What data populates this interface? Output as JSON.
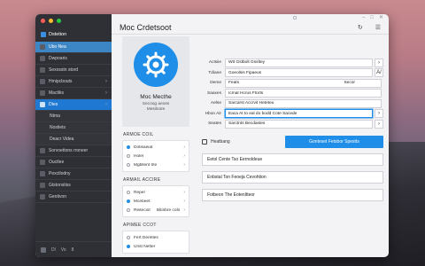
{
  "window": {
    "title": "Moc Crdetsoot"
  },
  "sidebar": {
    "header": "Dstetion",
    "items": [
      {
        "label": "Ubo Nea",
        "icon": "home-icon",
        "state": "first"
      },
      {
        "label": "Dwpoaris",
        "icon": "grid-icon",
        "state": ""
      },
      {
        "label": "Sexosstn stord",
        "icon": "shield-icon",
        "state": ""
      },
      {
        "label": "Hmipcbouts",
        "icon": "folder-icon",
        "state": "chev"
      },
      {
        "label": "Mactiks",
        "icon": "chart-icon",
        "state": "chev"
      },
      {
        "label": "Dtes",
        "icon": "user-icon",
        "state": "selected"
      },
      {
        "label": "Ntma",
        "icon": "",
        "state": "child"
      },
      {
        "label": "Nostiets",
        "icon": "",
        "state": "child"
      },
      {
        "label": "Deacr Videa",
        "icon": "",
        "state": "child"
      },
      {
        "label": "Sorvoettons rroneer",
        "icon": "list-icon",
        "state": ""
      },
      {
        "label": "Ouctlee",
        "icon": "doc-icon",
        "state": ""
      },
      {
        "label": "Pexctlodny",
        "icon": "chart-icon",
        "state": ""
      },
      {
        "label": "Gtstonstiss",
        "icon": "gear-icon",
        "state": ""
      },
      {
        "label": "Geotivon",
        "icon": "gear-icon",
        "state": ""
      }
    ],
    "bottom": {
      "left": "Dl",
      "mid": "Vo",
      "right": "8"
    }
  },
  "profile": {
    "name": "Moc Mecthe",
    "sub1": "Secoog aeoss",
    "sub2": "Mesiloote"
  },
  "sections": [
    {
      "title": "ARMOE COIL",
      "rows": [
        {
          "label": "Dotisaeiat",
          "on": true
        },
        {
          "label": "Holel",
          "on": false
        },
        {
          "label": "Mgbllent trle",
          "on": false
        }
      ]
    },
    {
      "title": "ARMAIL ACCIRE",
      "rows": [
        {
          "label": "Reper",
          "on": false,
          "suffix": ""
        },
        {
          "label": "Mcebeet",
          "on": true,
          "suffix": ""
        },
        {
          "label": "Reiteciot",
          "on": false,
          "suffix": "Bitinbre coln"
        }
      ]
    },
    {
      "title": "APIMEE CCOT",
      "rows": [
        {
          "label": "Fert Deretles",
          "on": false
        },
        {
          "label": "Unst Netter",
          "on": true
        }
      ]
    }
  ],
  "form": [
    {
      "label": "Actsiie",
      "value": "Wtt Gstbolt Gssltey",
      "action": "›"
    },
    {
      "label": "Tdiane",
      "value": "Goeolsis Fipaeus",
      "action": "A/"
    },
    {
      "label": "Deme",
      "value": "Feats",
      "extra": "Secor",
      "action": ""
    },
    {
      "label": "Saaxes",
      "value": "Icmat Hcrus Ftorts",
      "action": ""
    },
    {
      "label": "Aelse",
      "value": "Sarcarst Accrvit Heteteu",
      "action": ""
    },
    {
      "label": "Hbon Air",
      "value": "Eaca At to eal do bodd Cote Sacede",
      "action": "›",
      "focused": true
    },
    {
      "label": "Seates",
      "value": "Sarctnts Becdastes",
      "action": "›"
    }
  ],
  "toggle": {
    "label": "Heatbang",
    "button": "Gonteset Fetsbor Spestts"
  },
  "list_fields": [
    "Eetol Cente Tso Eernoldeue",
    "Enbstal Ton Feoeja Cevohtion",
    "Fotbeon The Eotenltteor"
  ],
  "colors": {
    "accent": "#1e8ee8",
    "sidebar": "#2e3035"
  }
}
